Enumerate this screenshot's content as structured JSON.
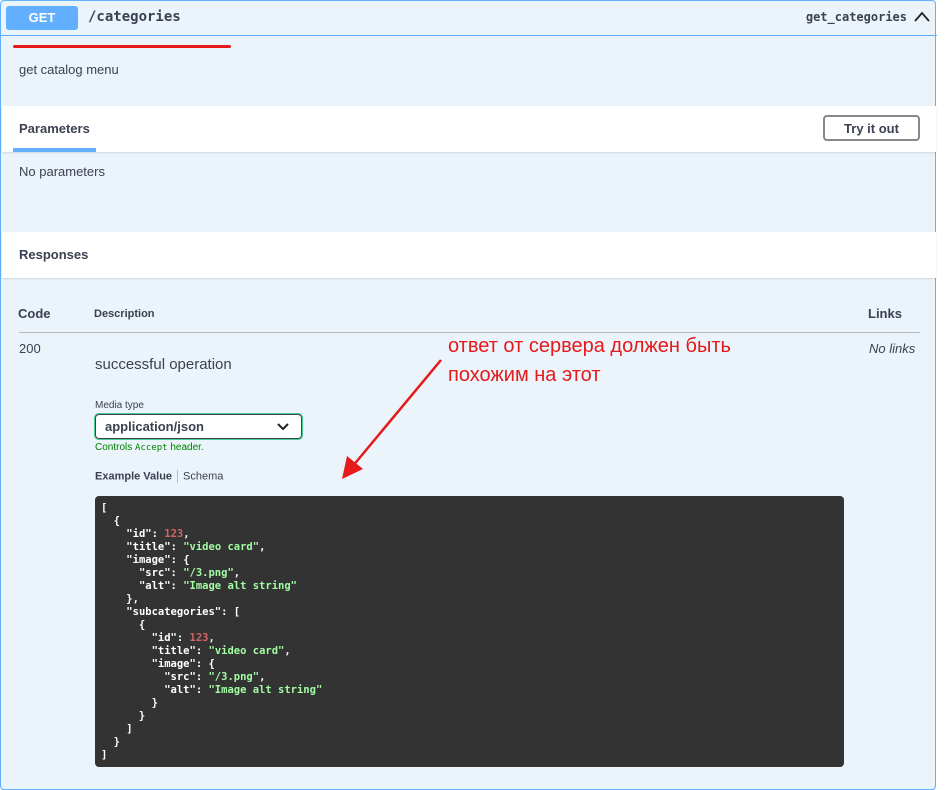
{
  "operation": {
    "method": "GET",
    "path": "/categories",
    "operation_id": "get_categories",
    "description": "get catalog menu"
  },
  "parameters": {
    "title": "Parameters",
    "try_label": "Try it out",
    "empty_text": "No parameters"
  },
  "responses": {
    "title": "Responses",
    "columns": {
      "code": "Code",
      "description": "Description",
      "links": "Links"
    },
    "rows": [
      {
        "code": "200",
        "description": "successful operation",
        "links": "No links",
        "media_type_label": "Media type",
        "media_type": "application/json",
        "controls_prefix": "Controls",
        "controls_header": "Accept",
        "controls_suffix": "header.",
        "tab_example": "Example Value",
        "tab_schema": "Schema"
      }
    ]
  },
  "example_json_lines": [
    [
      {
        "t": "p",
        "v": "["
      }
    ],
    [
      {
        "t": "p",
        "v": "  {"
      }
    ],
    [
      {
        "t": "p",
        "v": "    "
      },
      {
        "t": "k",
        "v": "\"id\""
      },
      {
        "t": "p",
        "v": ": "
      },
      {
        "t": "n",
        "v": "123"
      },
      {
        "t": "p",
        "v": ","
      }
    ],
    [
      {
        "t": "p",
        "v": "    "
      },
      {
        "t": "k",
        "v": "\"title\""
      },
      {
        "t": "p",
        "v": ": "
      },
      {
        "t": "s",
        "v": "\"video card\""
      },
      {
        "t": "p",
        "v": ","
      }
    ],
    [
      {
        "t": "p",
        "v": "    "
      },
      {
        "t": "k",
        "v": "\"image\""
      },
      {
        "t": "p",
        "v": ": {"
      }
    ],
    [
      {
        "t": "p",
        "v": "      "
      },
      {
        "t": "k",
        "v": "\"src\""
      },
      {
        "t": "p",
        "v": ": "
      },
      {
        "t": "s",
        "v": "\"/3.png\""
      },
      {
        "t": "p",
        "v": ","
      }
    ],
    [
      {
        "t": "p",
        "v": "      "
      },
      {
        "t": "k",
        "v": "\"alt\""
      },
      {
        "t": "p",
        "v": ": "
      },
      {
        "t": "s",
        "v": "\"Image alt string\""
      }
    ],
    [
      {
        "t": "p",
        "v": "    },"
      }
    ],
    [
      {
        "t": "p",
        "v": "    "
      },
      {
        "t": "k",
        "v": "\"subcategories\""
      },
      {
        "t": "p",
        "v": ": ["
      }
    ],
    [
      {
        "t": "p",
        "v": "      {"
      }
    ],
    [
      {
        "t": "p",
        "v": "        "
      },
      {
        "t": "k",
        "v": "\"id\""
      },
      {
        "t": "p",
        "v": ": "
      },
      {
        "t": "n",
        "v": "123"
      },
      {
        "t": "p",
        "v": ","
      }
    ],
    [
      {
        "t": "p",
        "v": "        "
      },
      {
        "t": "k",
        "v": "\"title\""
      },
      {
        "t": "p",
        "v": ": "
      },
      {
        "t": "s",
        "v": "\"video card\""
      },
      {
        "t": "p",
        "v": ","
      }
    ],
    [
      {
        "t": "p",
        "v": "        "
      },
      {
        "t": "k",
        "v": "\"image\""
      },
      {
        "t": "p",
        "v": ": {"
      }
    ],
    [
      {
        "t": "p",
        "v": "          "
      },
      {
        "t": "k",
        "v": "\"src\""
      },
      {
        "t": "p",
        "v": ": "
      },
      {
        "t": "s",
        "v": "\"/3.png\""
      },
      {
        "t": "p",
        "v": ","
      }
    ],
    [
      {
        "t": "p",
        "v": "          "
      },
      {
        "t": "k",
        "v": "\"alt\""
      },
      {
        "t": "p",
        "v": ": "
      },
      {
        "t": "s",
        "v": "\"Image alt string\""
      }
    ],
    [
      {
        "t": "p",
        "v": "        }"
      }
    ],
    [
      {
        "t": "p",
        "v": "      }"
      }
    ],
    [
      {
        "t": "p",
        "v": "    ]"
      }
    ],
    [
      {
        "t": "p",
        "v": "  }"
      }
    ],
    [
      {
        "t": "p",
        "v": "]"
      }
    ]
  ],
  "annotation": {
    "line1": "ответ от сервера должен быть",
    "line2": "похожим на этот",
    "color": "#e51a1a"
  },
  "colors": {
    "get_accent": "#61affe",
    "block_bg": "#ebf3fb",
    "media_focus": "#49cc90",
    "code_bg": "#333333",
    "json_number": "#d36363",
    "json_string": "#a2fca2"
  },
  "icons": {
    "collapse": "chevron-up-icon",
    "select": "chevron-down-icon",
    "annotation_arrow": "arrow-icon"
  }
}
